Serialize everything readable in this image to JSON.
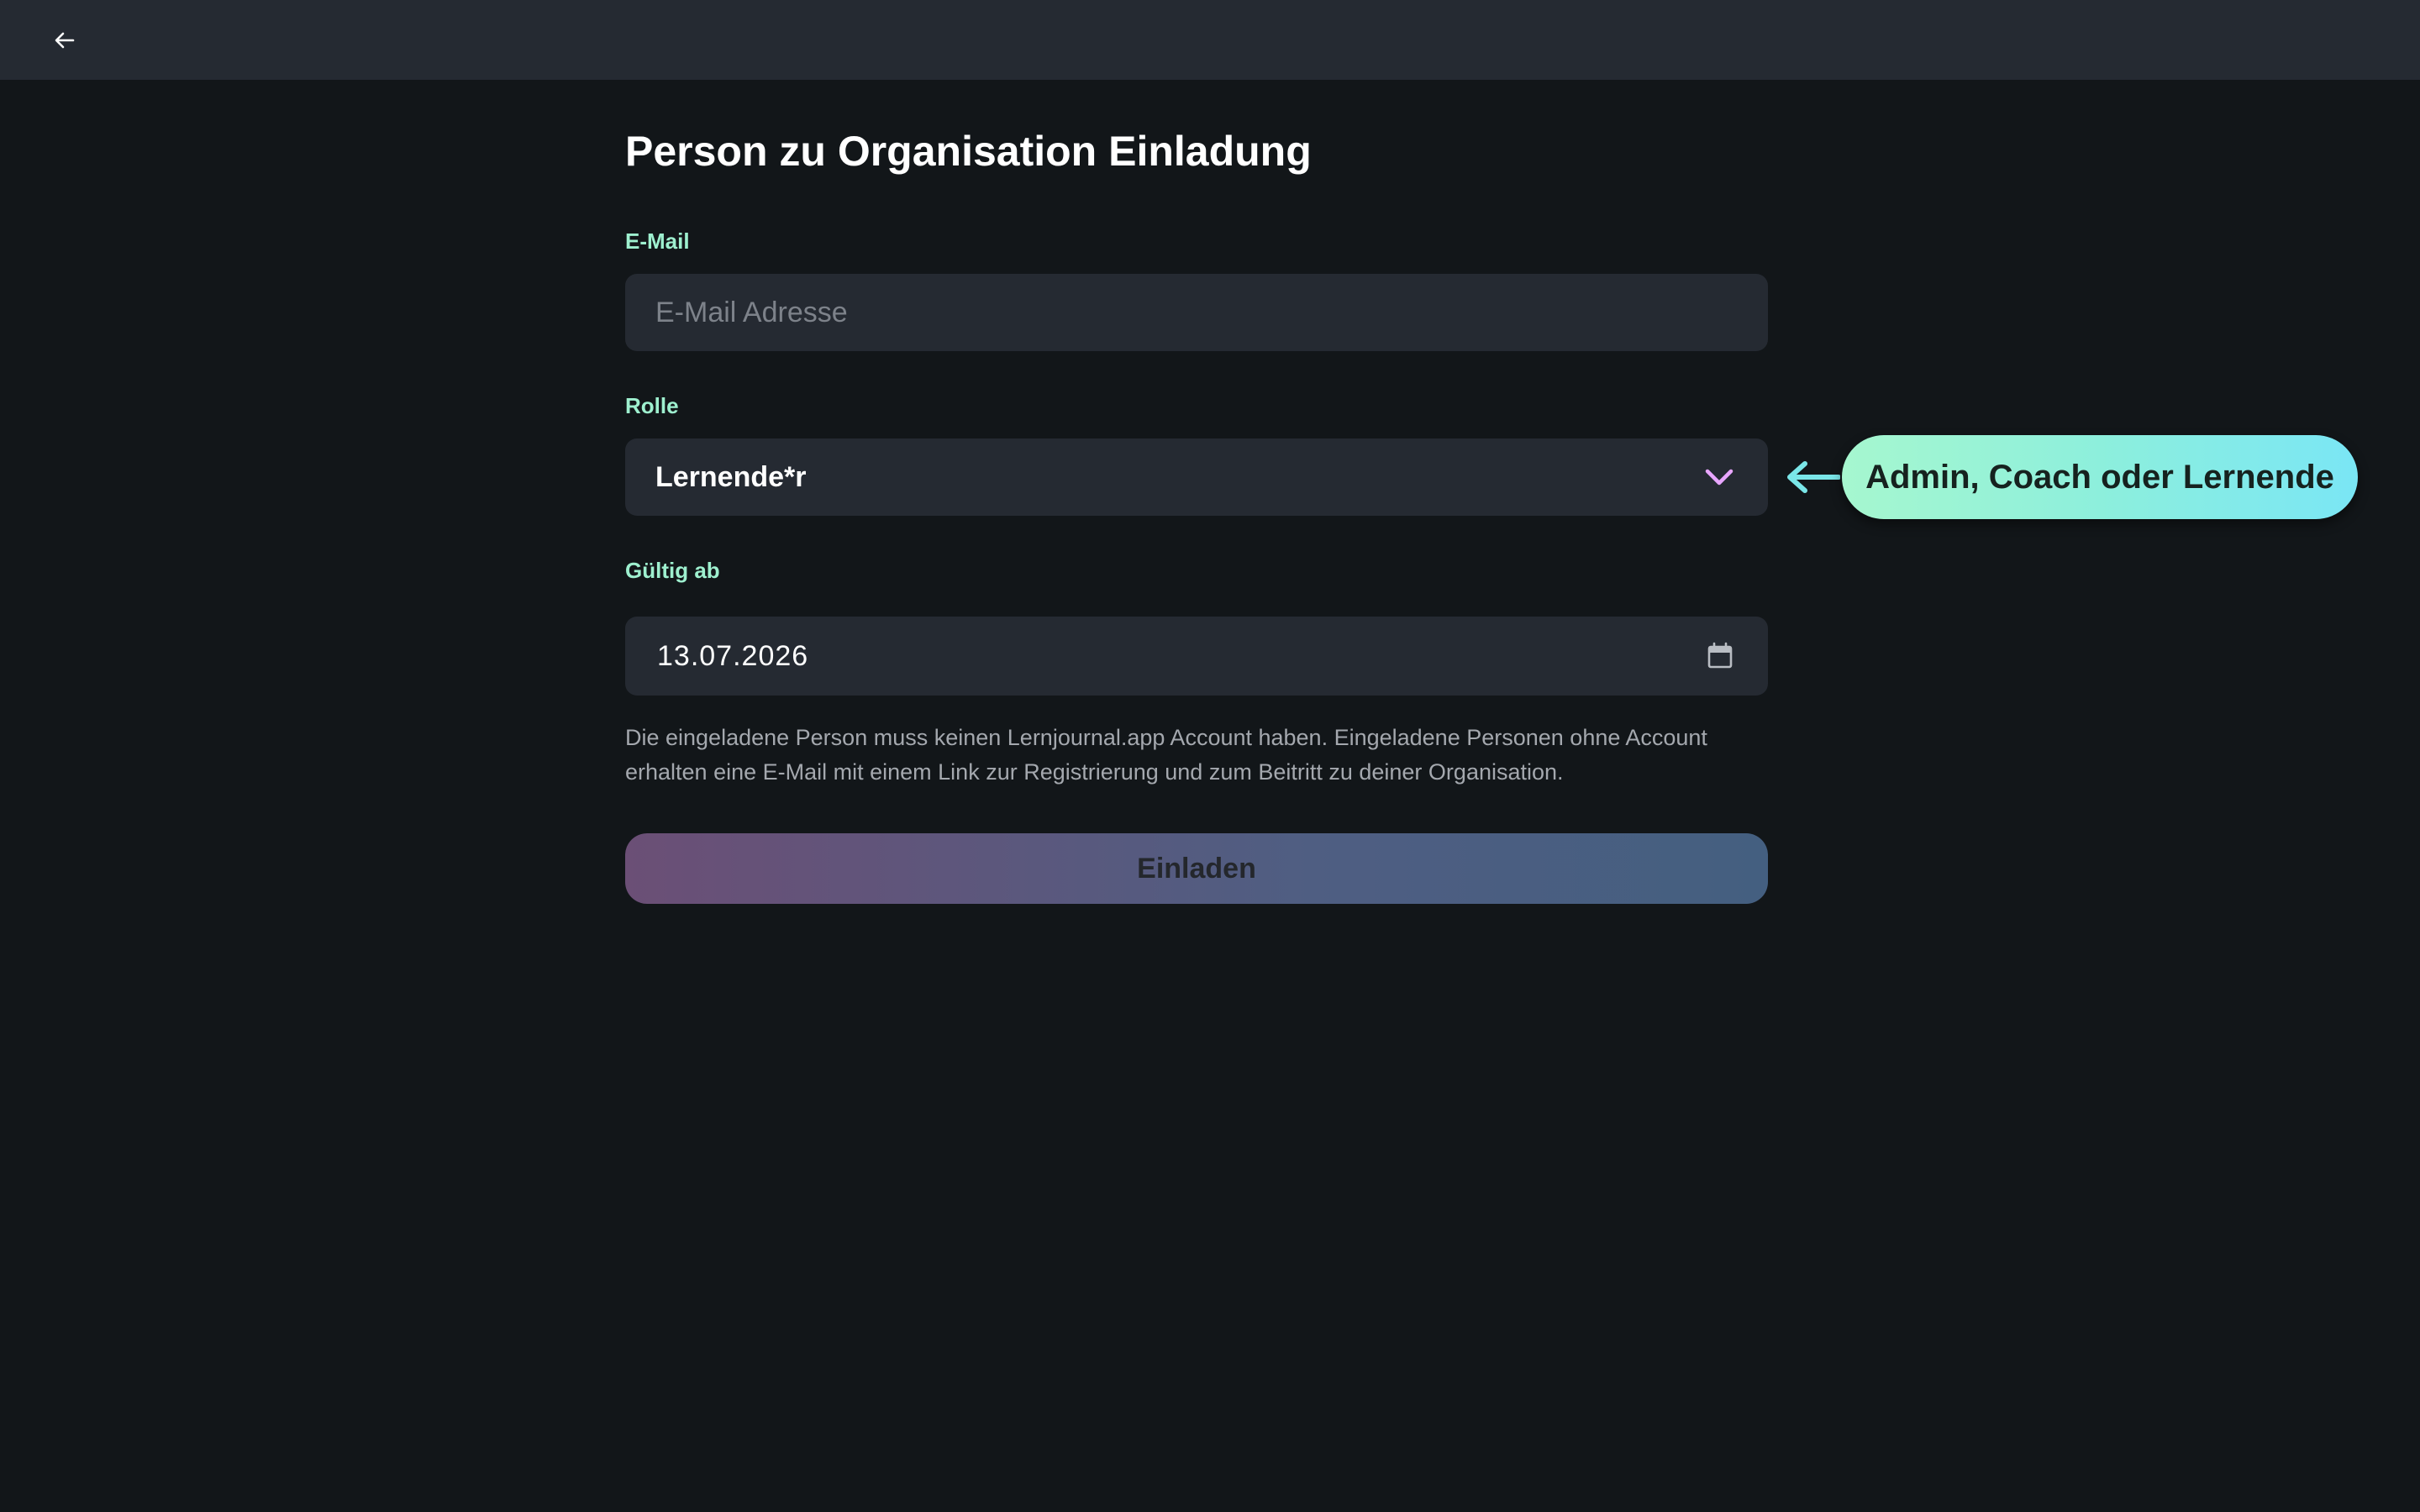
{
  "header": {
    "back_icon": "arrow-left-icon"
  },
  "page": {
    "title": "Person zu Organisation Einladung"
  },
  "form": {
    "email": {
      "label": "E-Mail",
      "value": "",
      "placeholder": "E-Mail Adresse"
    },
    "role": {
      "label": "Rolle",
      "selected": "Lernende*r",
      "icon": "chevron-down-icon"
    },
    "valid_from": {
      "label": "Gültig ab",
      "value": "13.07.2026",
      "icon": "calendar-icon"
    },
    "help_text": "Die eingeladene Person muss keinen Lernjournal.app Account haben. Eingeladene Personen ohne Account erhalten eine E-Mail mit einem Link zur Registrierung und zum Beitritt zu deiner Organisation.",
    "submit_label": "Einladen"
  },
  "annotation": {
    "text": "Admin, Coach oder Lernende",
    "icon": "arrow-left-icon"
  },
  "colors": {
    "background": "#121619",
    "surface": "#252a32",
    "label_accent": "#9ef0cf",
    "chevron_accent": "#e8a6ff",
    "callout_start": "#a6f7cf",
    "callout_end": "#7ae6f5"
  }
}
